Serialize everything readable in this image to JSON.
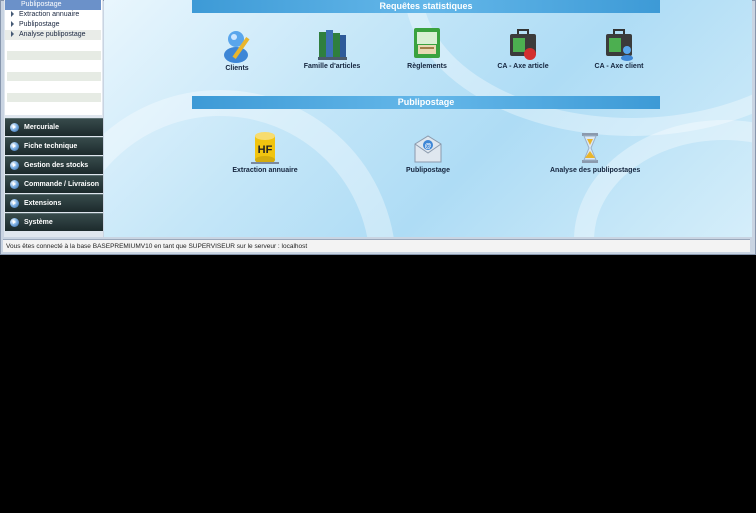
{
  "sidebar": {
    "tree": [
      {
        "label": "Publipostage",
        "selected": true
      },
      {
        "label": "Extraction annuaire",
        "selected": false
      },
      {
        "label": "Publipostage",
        "selected": false
      },
      {
        "label": "Analyse publipostage",
        "selected": false
      }
    ],
    "nav": [
      {
        "label": "Mercuriale"
      },
      {
        "label": "Fiche technique"
      },
      {
        "label": "Gestion des stocks"
      },
      {
        "label": "Commande / Livraison"
      },
      {
        "label": "Extensions"
      },
      {
        "label": "Système"
      }
    ]
  },
  "main": {
    "requetes": {
      "title": "Requêtes statistiques",
      "tiles": [
        {
          "label": "Clients",
          "icon": "user-icon"
        },
        {
          "label": "Famille d'articles",
          "icon": "books-icon"
        },
        {
          "label": "Règlements",
          "icon": "payments-icon"
        },
        {
          "label": "CA - Axe article",
          "icon": "briefcase-apple-icon"
        },
        {
          "label": "CA - Axe client",
          "icon": "briefcase-user-icon"
        }
      ]
    },
    "publipostage": {
      "title": "Publipostage",
      "tiles": [
        {
          "label": "Extraction annuaire",
          "icon": "hf-database-icon"
        },
        {
          "label": "Publipostage",
          "icon": "envelope-at-icon"
        },
        {
          "label": "Analyse des publipostages",
          "icon": "hourglass-icon"
        }
      ]
    }
  },
  "status": {
    "text": "Vous êtes connecté à la base BASEPREMIUMV10 en tant que SUPERVISEUR sur le serveur : localhost"
  },
  "colors": {
    "header_blue": "#4aa7e0",
    "nav_dark": "#26383a",
    "selected_row": "#6b91c9"
  }
}
